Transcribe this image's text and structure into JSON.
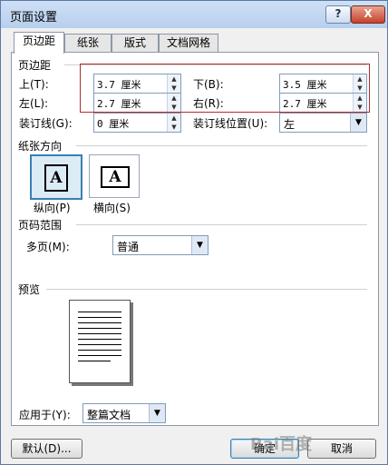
{
  "title": "页面设置",
  "titlebar": {
    "help": "?",
    "close": "X"
  },
  "tabs": [
    {
      "label": "页边距"
    },
    {
      "label": "纸张"
    },
    {
      "label": "版式"
    },
    {
      "label": "文档网格"
    }
  ],
  "margins": {
    "section_label": "页边距",
    "top": {
      "label": "上(T):",
      "value": "3.7 厘米"
    },
    "bottom": {
      "label": "下(B):",
      "value": "3.5 厘米"
    },
    "left": {
      "label": "左(L):",
      "value": "2.7 厘米"
    },
    "right": {
      "label": "右(R):",
      "value": "2.7 厘米"
    },
    "gutter": {
      "label": "装订线(G):",
      "value": "0 厘米"
    },
    "gutter_pos": {
      "label": "装订线位置(U):",
      "value": "左"
    }
  },
  "orientation": {
    "section_label": "纸张方向",
    "portrait_label": "纵向(P)",
    "landscape_label": "横向(S)",
    "glyph": "A"
  },
  "pages": {
    "section_label": "页码范围",
    "multi_label": "多页(M):",
    "multi_value": "普通"
  },
  "preview": {
    "section_label": "预览"
  },
  "apply": {
    "label": "应用于(Y):",
    "value": "整篇文档"
  },
  "buttons": {
    "default_label": "默认(D)...",
    "ok_label": "确定",
    "cancel_label": "取消"
  },
  "watermark": "Bai百度"
}
